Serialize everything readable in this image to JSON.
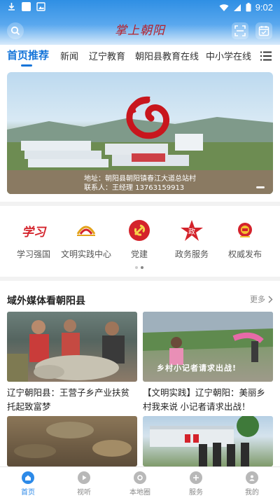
{
  "status_bar": {
    "time": "9:02"
  },
  "header": {
    "logo_text": "掌上朝阳"
  },
  "tabs": [
    {
      "label": "首页推荐",
      "active": true
    },
    {
      "label": "新闻"
    },
    {
      "label": "辽宁教育"
    },
    {
      "label": "朝阳县教育在线"
    },
    {
      "label": "中小学在线"
    }
  ],
  "banner": {
    "caption_line1": "地址：朝阳县朝阳镇春江大道总站村",
    "caption_line2": "联系人：王经理 13763159913"
  },
  "quick_icons": [
    {
      "label": "学习强国",
      "icon": "xuexi-qiangguo-icon"
    },
    {
      "label": "文明实践中心",
      "icon": "civilization-center-icon"
    },
    {
      "label": "党建",
      "icon": "party-emblem-icon"
    },
    {
      "label": "政务服务",
      "icon": "government-star-icon"
    },
    {
      "label": "权威发布",
      "icon": "national-emblem-icon"
    }
  ],
  "section": {
    "title": "域外媒体看朝阳县",
    "more": "更多"
  },
  "cards": [
    {
      "title": "辽宁朝阳县：王营子乡产业扶贫托起致富梦"
    },
    {
      "title": "【文明实践】辽宁朝阳：美丽乡村我来说 小记者请求出战！",
      "overlay": "乡村小记者请求出战!"
    },
    {
      "title": ""
    },
    {
      "title": ""
    }
  ],
  "bottom_nav": [
    {
      "label": "首页",
      "active": true,
      "icon": "home-icon"
    },
    {
      "label": "视听",
      "icon": "play-icon"
    },
    {
      "label": "本地圈",
      "icon": "local-circle-icon"
    },
    {
      "label": "服务",
      "icon": "service-icon"
    },
    {
      "label": "我的",
      "icon": "profile-icon"
    }
  ],
  "colors": {
    "accent": "#1675d9",
    "header_top": "#2f8fe4",
    "brand_red": "#c8161d"
  }
}
